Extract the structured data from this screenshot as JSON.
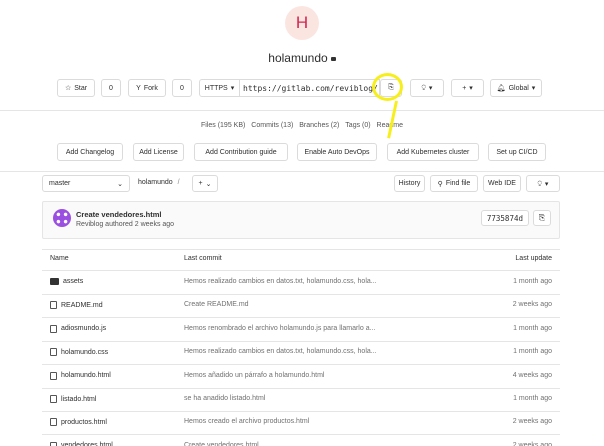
{
  "project": {
    "avatar_letter": "H",
    "name": "holamundo"
  },
  "header_actions": {
    "star_label": "Star",
    "star_count": "0",
    "fork_label": "Fork",
    "fork_count": "0",
    "protocol": "HTTPS",
    "clone_url": "https://gitlab.com/reviblog/",
    "global_label": "Global"
  },
  "stats": {
    "files": "Files (195 KB)",
    "commits": "Commits (13)",
    "branches": "Branches (2)",
    "tags": "Tags (0)",
    "readme": "Readme"
  },
  "quick_actions": [
    "Add Changelog",
    "Add License",
    "Add Contribution guide",
    "Enable Auto DevOps",
    "Add Kubernetes cluster",
    "Set up CI/CD"
  ],
  "toolbar": {
    "branch": "master",
    "path_root": "holamundo",
    "path_sep": "/",
    "plus": "+",
    "history": "History",
    "find_file": "Find file",
    "web_ide": "Web IDE"
  },
  "last_commit": {
    "title": "Create vendedores.html",
    "author_line": "Reviblog authored 2 weeks ago",
    "sha": "7735874d"
  },
  "table": {
    "headers": {
      "name": "Name",
      "commit": "Last commit",
      "update": "Last update"
    },
    "rows": [
      {
        "name": "assets",
        "type": "folder",
        "commit": "Hemos realizado cambios en datos.txt, holamundo.css, hola...",
        "update": "1 month ago"
      },
      {
        "name": "README.md",
        "type": "file",
        "commit": "Create README.md",
        "update": "2 weeks ago"
      },
      {
        "name": "adiosmundo.js",
        "type": "file",
        "commit": "Hemos renombrado el archivo holamundo.js para llamarlo a...",
        "update": "1 month ago"
      },
      {
        "name": "holamundo.css",
        "type": "file",
        "commit": "Hemos realizado cambios en datos.txt, holamundo.css, hola...",
        "update": "1 month ago"
      },
      {
        "name": "holamundo.html",
        "type": "file",
        "commit": "Hemos añadido un párrafo a holamundo.html",
        "update": "4 weeks ago"
      },
      {
        "name": "listado.html",
        "type": "file",
        "commit": "se ha anadido listado.html",
        "update": "1 month ago"
      },
      {
        "name": "productos.html",
        "type": "file",
        "commit": "Hemos creado el archivo productos.html",
        "update": "2 weeks ago"
      },
      {
        "name": "vendedores.html",
        "type": "file",
        "commit": "Create vendedores.html",
        "update": "2 weeks ago"
      }
    ]
  },
  "colors": {
    "highlight": "#f7ef1c",
    "avatar_bg": "#fbe5e1",
    "avatar_fg": "#d22852"
  }
}
